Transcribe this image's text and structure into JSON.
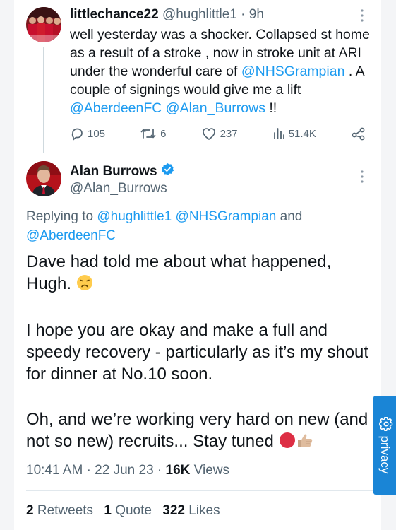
{
  "tweet1": {
    "display_name": "littlechance22",
    "handle": "@hughlittle1",
    "separator": "·",
    "time": "9h",
    "text_before": "well yesterday was a shocker. Collapsed st home as a result of a stroke , now in stroke unit at ARI under the wonderful care of ",
    "mention_nhs": "@NHSGrampian",
    "text_middle": " . A couple of signings would give me a lift ",
    "mention_afc": "@AberdeenFC",
    "mention_alan": "@Alan_Burrows",
    "text_end": " !!",
    "replies": "105",
    "retweets": "6",
    "likes": "237",
    "views": "51.4K",
    "icons": [
      "reply-icon",
      "retweet-icon",
      "like-icon",
      "views-icon",
      "share-icon",
      "more-icon"
    ]
  },
  "tweet2": {
    "display_name": "Alan Burrows",
    "handle": "@Alan_Burrows",
    "replying_label": "Replying to",
    "replying_to": [
      "@hughlittle1",
      "@NHSGrampian",
      "and",
      "@AberdeenFC"
    ],
    "paragraph1": "Dave had told me about what happened, Hugh.",
    "paragraph2": "I hope you are okay and make a full and speedy recovery - particularly as it’s my shout for dinner at No.10 soon.",
    "paragraph3": "Oh, and we’re working very hard on new (and not so new) recruits... Stay tuned",
    "time": "10:41 AM",
    "date": "22 Jun 23",
    "dot": "·",
    "views_count": "16K",
    "views_label": "Views",
    "retweets_count": "2",
    "retweets_label": "Retweets",
    "quotes_count": "1",
    "quotes_label": "Quote",
    "likes_count": "322",
    "likes_label": "Likes",
    "icons": [
      "verified-badge-icon",
      "sad-face-emoji",
      "red-circle-emoji",
      "thumbs-up-emoji",
      "more-icon"
    ]
  },
  "privacy_tab": {
    "label": "privacy",
    "icon": "gear-icon"
  },
  "colors": {
    "link": "#1d9bf0",
    "secondary_text": "#536471",
    "primary_text": "#0f1419",
    "privacy_tab": "#1a85d6"
  }
}
